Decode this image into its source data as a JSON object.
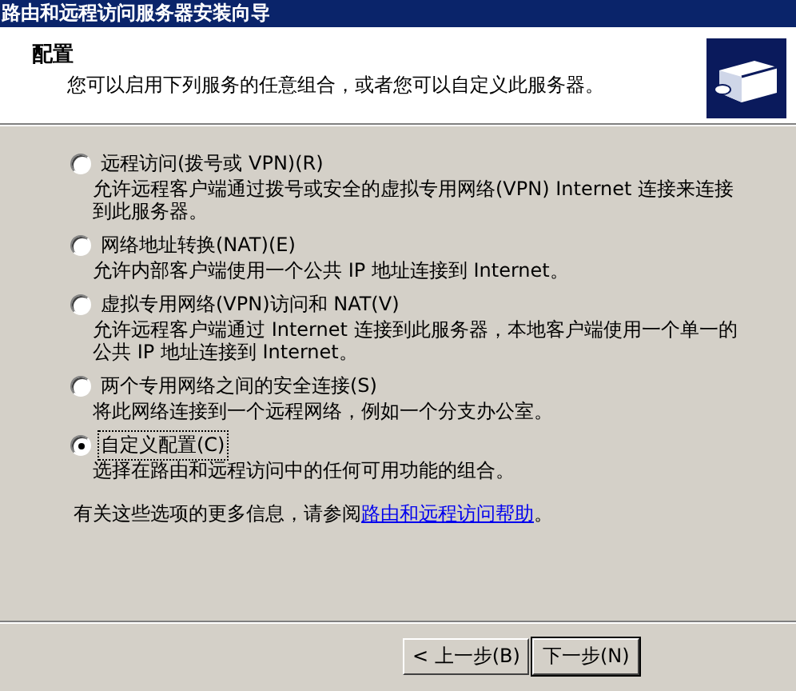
{
  "window": {
    "title": "路由和远程访问服务器安装向导"
  },
  "header": {
    "heading": "配置",
    "subtitle": "您可以启用下列服务的任意组合，或者您可以自定义此服务器。"
  },
  "options": [
    {
      "label": "远程访问(拨号或 VPN)(R)",
      "description": "允许远程客户端通过拨号或安全的虚拟专用网络(VPN) Internet 连接来连接到此服务器。",
      "selected": false
    },
    {
      "label": "网络地址转换(NAT)(E)",
      "description": "允许内部客户端使用一个公共 IP 地址连接到 Internet。",
      "selected": false
    },
    {
      "label": "虚拟专用网络(VPN)访问和 NAT(V)",
      "description": "允许远程客户端通过 Internet 连接到此服务器，本地客户端使用一个单一的公共 IP 地址连接到 Internet。",
      "selected": false
    },
    {
      "label": "两个专用网络之间的安全连接(S)",
      "description": "将此网络连接到一个远程网络，例如一个分支办公室。",
      "selected": false
    },
    {
      "label": "自定义配置(C)",
      "description": "选择在路由和远程访问中的任何可用功能的组合。",
      "selected": true
    }
  ],
  "footer": {
    "text": "有关这些选项的更多信息，请参阅",
    "link": "路由和远程访问帮助",
    "end": "。"
  },
  "buttons": [
    {
      "label": "< 上一步(B)",
      "default": false
    },
    {
      "label": "下一步(N)",
      "default": true
    }
  ]
}
